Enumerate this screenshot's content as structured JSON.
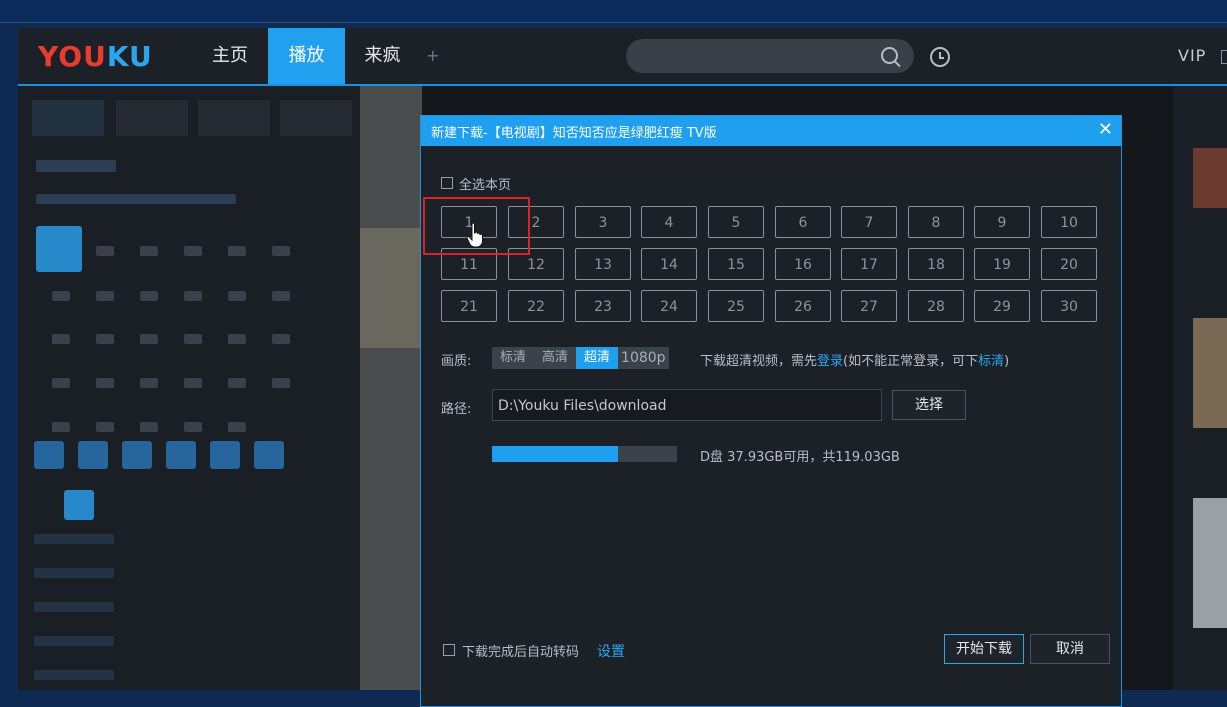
{
  "brand": {
    "logo_you": "YOU",
    "logo_ku": "KU"
  },
  "nav": {
    "items": [
      "主页",
      "播放",
      "来疯"
    ],
    "active_index": 1,
    "add_label": "+"
  },
  "top_right": {
    "vip": "VIP"
  },
  "dialog": {
    "title": "新建下载-【电视剧】知否知否应是绿肥红瘦 TV版",
    "close": "✕",
    "select_all": "全选本页",
    "episodes": [
      "1",
      "2",
      "3",
      "4",
      "5",
      "6",
      "7",
      "8",
      "9",
      "10",
      "11",
      "12",
      "13",
      "14",
      "15",
      "16",
      "17",
      "18",
      "19",
      "20",
      "21",
      "22",
      "23",
      "24",
      "25",
      "26",
      "27",
      "28",
      "29",
      "30"
    ],
    "quality": {
      "label": "画质:",
      "options": [
        "标清",
        "高清",
        "超清",
        "1080p"
      ],
      "selected": "超清",
      "hint_prefix": "下载超清视频，需先",
      "hint_login": "登录",
      "hint_middle": "(如不能正常登录，可下",
      "hint_fallback": "标清",
      "hint_suffix": ")"
    },
    "path": {
      "label": "路径:",
      "value": "D:\\Youku Files\\download",
      "choose_button": "选择"
    },
    "disk": {
      "used_fraction": 0.68,
      "info": "D盘 37.93GB可用，共119.03GB"
    },
    "auto_transcode": {
      "label": "下载完成后自动转码",
      "settings_link": "设置"
    },
    "start_button": "开始下载",
    "cancel_button": "取消"
  },
  "colors": {
    "accent": "#1e9fef",
    "logo_red": "#e93c2e",
    "highlight": "#d9232b"
  }
}
